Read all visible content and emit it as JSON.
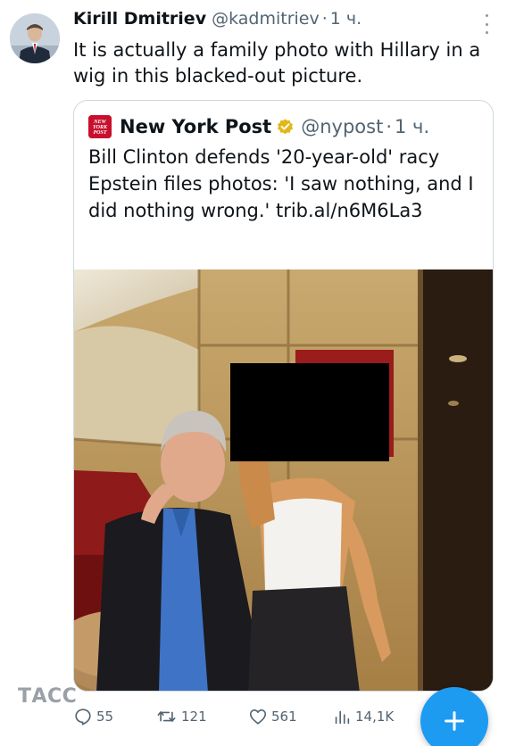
{
  "tweet": {
    "author_name": "Kirill Dmitriev",
    "author_handle": "@kadmitriev",
    "separator": "·",
    "time": "1 ч.",
    "text": "It is actually a family photo with Hillary in a wig in this blacked-out picture."
  },
  "quoted_tweet": {
    "logo_text": "NEW YORK POST",
    "author_name": "New York Post",
    "author_handle": "@nypost",
    "separator": "·",
    "time": "1 ч.",
    "text": "Bill Clinton defends '20-year-old' racy Epstein files photos: 'I saw nothing, and I did nothing wrong.' trib.al/n6M6La3"
  },
  "watermark": "ТАСС",
  "actions": {
    "replies": "55",
    "reposts": "121",
    "likes": "561",
    "views": "14,1K"
  },
  "icons": {
    "more": "more-icon",
    "verified": "verified-gold-icon",
    "reply": "reply-icon",
    "repost": "repost-icon",
    "like": "heart-icon",
    "views": "views-icon",
    "compose": "plus-icon"
  },
  "colors": {
    "accent": "#1d9bf0",
    "verified_gold": "#e2b719",
    "nypost_red": "#c8102e",
    "secondary_text": "#536471"
  }
}
